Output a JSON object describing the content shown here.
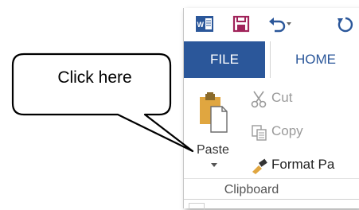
{
  "qat": {
    "word_icon_letters": "W",
    "items": [
      "word-logo-icon",
      "save-icon",
      "undo-icon",
      "redo-icon"
    ]
  },
  "tabs": {
    "file": "FILE",
    "home": "HOME"
  },
  "clipboard": {
    "paste": "Paste",
    "cut": "Cut",
    "copy": "Copy",
    "format_painter": "Format Pa",
    "group_label": "Clipboard"
  },
  "callout": {
    "text": "Click here"
  },
  "colors": {
    "file_tab_bg": "#2b579a",
    "accent": "#2b579a",
    "save_icon": "#a0235a",
    "paste_clipboard": "#e0a640"
  }
}
